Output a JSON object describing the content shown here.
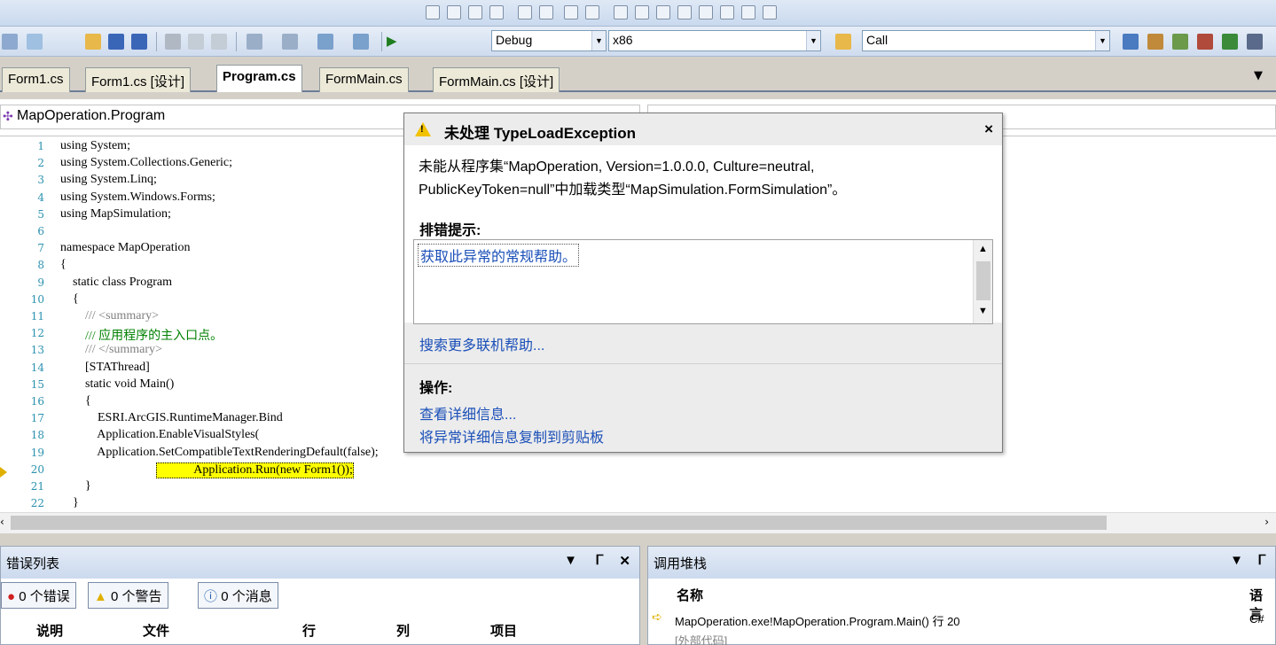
{
  "toolbar": {
    "config": "Debug",
    "platform": "x86",
    "find": "Call"
  },
  "tabs": [
    {
      "label": "Form1.cs"
    },
    {
      "label": "Form1.cs [设计]"
    },
    {
      "label": "Program.cs"
    },
    {
      "label": "FormMain.cs"
    },
    {
      "label": "FormMain.cs [设计]"
    }
  ],
  "nav": {
    "class_path": "MapOperation.Program"
  },
  "code": {
    "lines": [
      {
        "n": "1",
        "text": "using System;"
      },
      {
        "n": "2",
        "text": "using System.Collections.Generic;"
      },
      {
        "n": "3",
        "text": "using System.Linq;"
      },
      {
        "n": "4",
        "text": "using System.Windows.Forms;"
      },
      {
        "n": "5",
        "text": "using MapSimulation;"
      },
      {
        "n": "6",
        "text": ""
      },
      {
        "n": "7",
        "text": "namespace MapOperation"
      },
      {
        "n": "8",
        "text": "{"
      },
      {
        "n": "9",
        "text": "    static class Program"
      },
      {
        "n": "10",
        "text": "    {"
      },
      {
        "n": "11",
        "text": "        /// <summary>"
      },
      {
        "n": "12",
        "text": "        /// 应用程序的主入口点。"
      },
      {
        "n": "13",
        "text": "        /// </summary>"
      },
      {
        "n": "14",
        "text": "        [STAThread]"
      },
      {
        "n": "15",
        "text": "        static void Main()"
      },
      {
        "n": "16",
        "text": "        {"
      },
      {
        "n": "17",
        "text": "            ESRI.ArcGIS.RuntimeManager.Bind"
      },
      {
        "n": "18",
        "text": "            Application.EnableVisualStyles("
      },
      {
        "n": "19",
        "text": "            Application.SetCompatibleTextRenderingDefault(false);"
      },
      {
        "n": "20",
        "text": "            Application.Run(new Form1());"
      },
      {
        "n": "21",
        "text": "        }"
      },
      {
        "n": "22",
        "text": "    }"
      }
    ]
  },
  "exception": {
    "title": "未处理 TypeLoadException",
    "message_line1": "未能从程序集“MapOperation, Version=1.0.0.0, Culture=neutral,",
    "message_line2": "PublicKeyToken=null”中加载类型“MapSimulation.FormSimulation”。",
    "tips_heading": "排错提示:",
    "tip_item": "获取此异常的常规帮助。",
    "search_link": "搜索更多联机帮助...",
    "actions_heading": "操作:",
    "action_details": "查看详细信息...",
    "action_copy": "将异常详细信息复制到剪贴板",
    "close_glyph": "×"
  },
  "error_list": {
    "title": "错误列表",
    "errors": "0 个错误",
    "warnings": "0 个警告",
    "messages": "0 个消息",
    "columns": [
      "说明",
      "文件",
      "行",
      "列",
      "项目"
    ]
  },
  "call_stack": {
    "title": "调用堆栈",
    "col_name": "名称",
    "col_lang": "语言",
    "rows": [
      {
        "name": "MapOperation.exe!MapOperation.Program.Main() 行 20",
        "lang": "C#"
      },
      {
        "name": "[外部代码]",
        "lang": ""
      }
    ]
  },
  "colors": {
    "accent": "#1a4fb8",
    "highlight": "#ffff00",
    "warning": "#f2c200"
  }
}
